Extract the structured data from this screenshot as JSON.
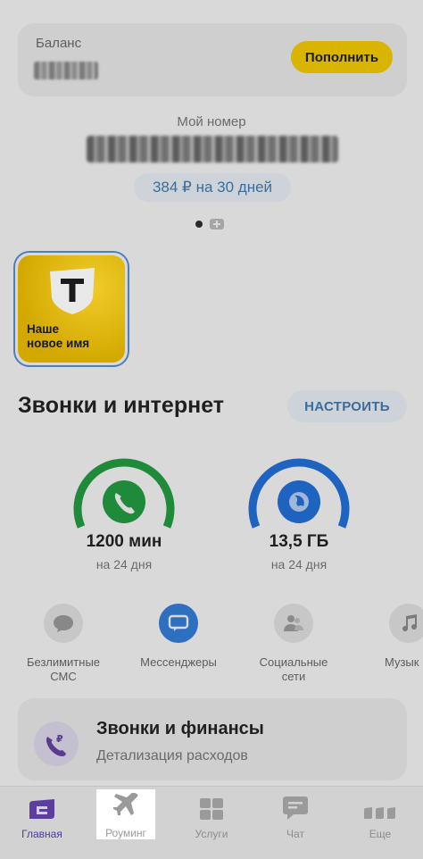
{
  "balance": {
    "label": "Баланс",
    "topup_label": "Пополнить"
  },
  "number": {
    "label": "Мой номер",
    "tariff": "384 ₽ на 30 дней"
  },
  "story": {
    "line1": "Наше",
    "line2": "новое имя",
    "logo_letter": "T"
  },
  "calls_section": {
    "title": "Звонки и интернет",
    "configure_label": "НАСТРОИТЬ",
    "gauges": [
      {
        "value": "1200 мин",
        "sub": "на 24 дня",
        "color": "#1f8a3a"
      },
      {
        "value": "13,5 ГБ",
        "sub": "на 24 дня",
        "color": "#1f63c0"
      }
    ]
  },
  "options": [
    {
      "label_line1": "Безлимитные",
      "label_line2": "СМС"
    },
    {
      "label_line1": "Мессенджеры",
      "label_line2": ""
    },
    {
      "label_line1": "Социальные",
      "label_line2": "сети"
    },
    {
      "label_line1": "Музык",
      "label_line2": ""
    }
  ],
  "finance": {
    "title": "Звонки и финансы",
    "sub": "Детализация расходов"
  },
  "nav": {
    "home": "Главная",
    "roaming": "Роуминг",
    "services": "Услуги",
    "chat": "Чат",
    "more": "Еще"
  },
  "colors": {
    "accent_yellow": "#d9b400",
    "accent_blue": "#3c6c99",
    "nav_active": "#4b3aa0"
  }
}
